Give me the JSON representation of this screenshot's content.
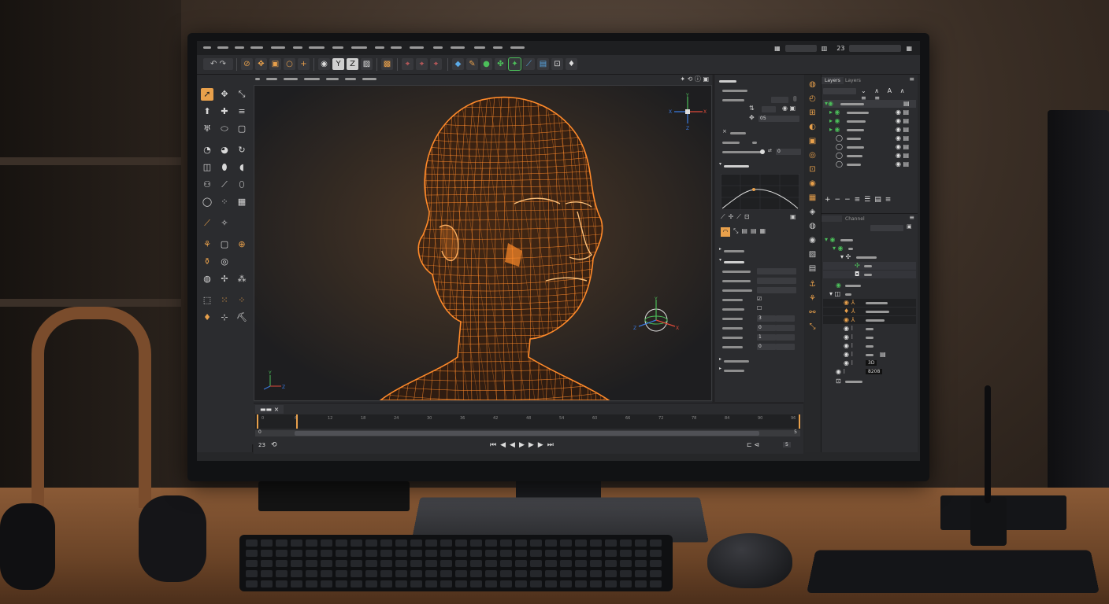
{
  "app": {
    "menubar": {
      "frame_counter": "23"
    },
    "toolbar": {
      "groups": [
        [
          "undo-icon",
          "redo-icon"
        ],
        [
          "lasso-icon",
          "move-icon",
          "frame-icon",
          "circle-icon",
          "crosshair-icon"
        ],
        [
          "camera-icon",
          "tag-icon",
          "z-icon",
          "picture-icon"
        ],
        [
          "render-icon"
        ],
        [
          "key-frame-icon",
          "key-frame-icon",
          "key-frame-icon"
        ],
        [
          "cube-icon",
          "sculpt-icon",
          "sphere-icon",
          "node-icon",
          "light-icon",
          "brush-icon",
          "table-icon",
          "display-icon",
          "bulb-icon"
        ]
      ]
    },
    "attributes": {
      "field_value": "05",
      "numeric_a": "0",
      "spinner_values": [
        "3",
        "0",
        "1",
        "0"
      ]
    },
    "timeline": {
      "frames": [
        "0",
        "6",
        "12",
        "18",
        "24",
        "30",
        "36",
        "42",
        "48",
        "54",
        "60",
        "66",
        "72",
        "78",
        "84",
        "90",
        "96"
      ],
      "start_field": "0",
      "end_field": "5",
      "current_frame": "23",
      "playback": [
        "first-frame-icon",
        "prev-key-icon",
        "prev-frame-icon",
        "play-icon",
        "next-frame-icon",
        "next-key-icon",
        "last-frame-icon"
      ]
    },
    "outliner": {
      "tabs": [
        "Layers",
        "Layers"
      ],
      "panel_tabs": [
        "",
        "Channel"
      ],
      "tree_values": [
        "3D",
        "8208"
      ]
    },
    "colors": {
      "accent": "#e8a04b",
      "wire": "#ff8a2a",
      "green": "#4cbf5a",
      "panel": "#2b2c2f",
      "viewport_bg": "#1e1e20"
    }
  }
}
